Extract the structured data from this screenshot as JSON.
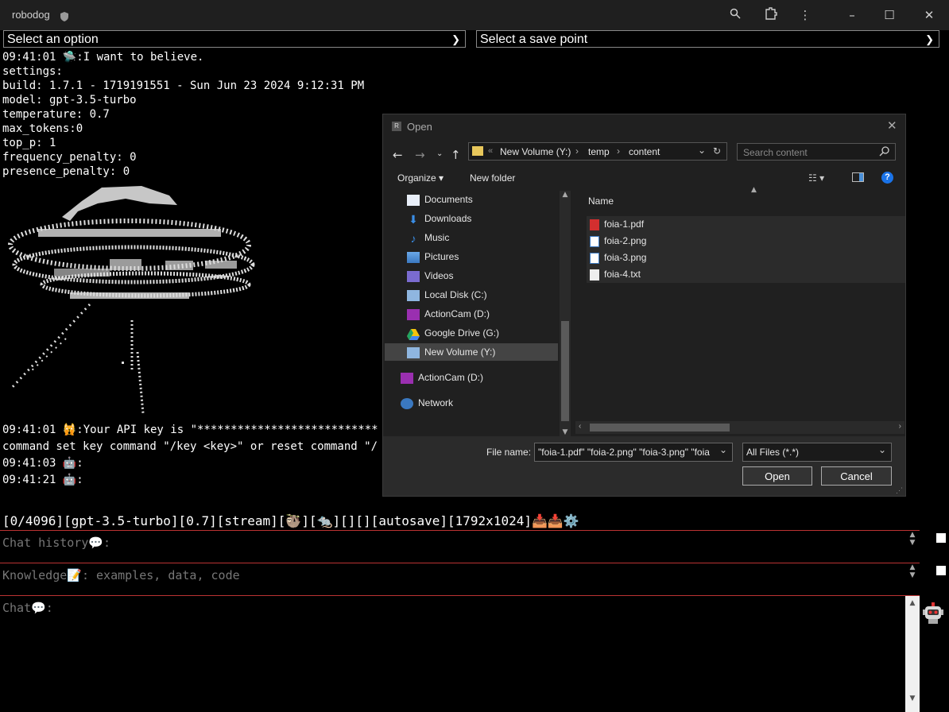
{
  "app": {
    "title": "robodog"
  },
  "titlebar": {
    "icons": [
      "shield-icon",
      "zoom-icon",
      "extensions-icon",
      "more-icon",
      "minimize-icon",
      "maximize-icon",
      "close-icon"
    ]
  },
  "selects": {
    "option": "Select an option",
    "savepoint": "Select a save point"
  },
  "console": {
    "lines": [
      "09:41:01 🛸:I want to believe.",
      "settings:",
      "build: 1.7.1 - 1719191551 - Sun Jun 23 2024 9:12:31 PM",
      "model: gpt-3.5-turbo",
      "temperature: 0.7",
      "max_tokens:0",
      "top_p: 1",
      "frequency_penalty: 0",
      "presence_penalty: 0"
    ],
    "apikey_line": "09:41:01 🙀:Your API key is \"***************************",
    "command_line": "command set key command \"/key <key>\" or reset command \"/",
    "ts1": "09:41:03 🤖:",
    "ts2": "09:41:21 🤖:"
  },
  "status": "[0/4096][gpt-3.5-turbo][0.7][stream][🦥][🐀][][][autosave][1792x1024]📥📥⚙️",
  "textareas": {
    "history": "Chat history💬:",
    "knowledge": "Knowledge📝: examples, data, code",
    "chat": "Chat💬:"
  },
  "dialog": {
    "title": "Open",
    "breadcrumb": [
      "New Volume (Y:)",
      "temp",
      "content"
    ],
    "search_placeholder": "Search content",
    "organize": "Organize ▾",
    "new_folder": "New folder",
    "sidebar": [
      {
        "label": "Documents",
        "icon": "documents-icon"
      },
      {
        "label": "Downloads",
        "icon": "downloads-icon"
      },
      {
        "label": "Music",
        "icon": "music-icon"
      },
      {
        "label": "Pictures",
        "icon": "pictures-icon"
      },
      {
        "label": "Videos",
        "icon": "videos-icon"
      },
      {
        "label": "Local Disk (C:)",
        "icon": "drive-icon"
      },
      {
        "label": "ActionCam (D:)",
        "icon": "sd-card-icon"
      },
      {
        "label": "Google Drive (G:)",
        "icon": "google-drive-icon"
      },
      {
        "label": "New Volume (Y:)",
        "icon": "drive-icon"
      },
      {
        "label": "ActionCam (D:)",
        "icon": "sd-card-icon"
      },
      {
        "label": "Network",
        "icon": "network-icon"
      }
    ],
    "column_name": "Name",
    "files": [
      {
        "name": "foia-1.pdf",
        "icon": "pdf-icon"
      },
      {
        "name": "foia-2.png",
        "icon": "image-icon"
      },
      {
        "name": "foia-3.png",
        "icon": "image-icon"
      },
      {
        "name": "foia-4.txt",
        "icon": "text-icon"
      }
    ],
    "filename_label": "File name:",
    "filename_value": "\"foia-1.pdf\" \"foia-2.png\" \"foia-3.png\" \"foia",
    "filetype": "All Files (*.*)",
    "open": "Open",
    "cancel": "Cancel"
  },
  "colors": {
    "accent_red": "#b33333",
    "dialog_bg": "#202020",
    "selected_bg": "#444444"
  }
}
